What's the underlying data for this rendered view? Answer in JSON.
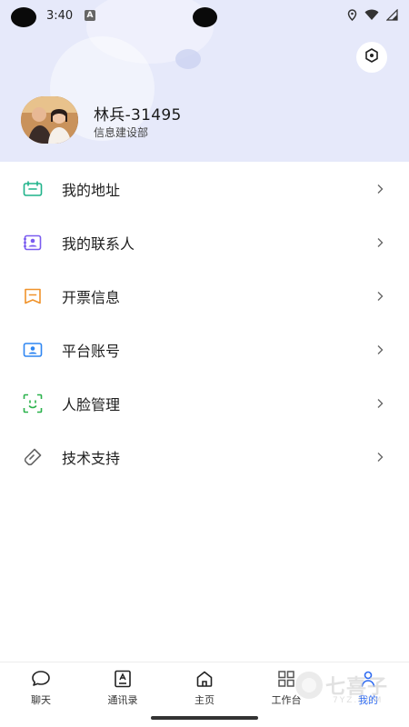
{
  "status_bar": {
    "time": "3:40",
    "notification_icon": "A"
  },
  "profile": {
    "name": "林兵-31495",
    "department": "信息建设部",
    "avatar": "profile-photo"
  },
  "menu": {
    "items": [
      {
        "label": "我的地址",
        "icon": "address-icon",
        "color": "#1fb38a"
      },
      {
        "label": "我的联系人",
        "icon": "contacts-icon",
        "color": "#7a5cf0"
      },
      {
        "label": "开票信息",
        "icon": "invoice-icon",
        "color": "#f0932b"
      },
      {
        "label": "平台账号",
        "icon": "account-icon",
        "color": "#2f86f2"
      },
      {
        "label": "人脸管理",
        "icon": "face-icon",
        "color": "#2bb24c"
      },
      {
        "label": "技术支持",
        "icon": "support-icon",
        "color": "#666666"
      }
    ]
  },
  "bottom_nav": {
    "items": [
      {
        "label": "聊天",
        "icon": "chat-icon"
      },
      {
        "label": "通讯录",
        "icon": "address-book-icon"
      },
      {
        "label": "主页",
        "icon": "home-icon"
      },
      {
        "label": "工作台",
        "icon": "workbench-icon"
      },
      {
        "label": "我的",
        "icon": "me-icon",
        "active": true
      }
    ]
  },
  "watermark": {
    "text": "七喜子",
    "sub": "7YZ.COM"
  },
  "colors": {
    "header_bg": "#e6e9fa",
    "accent": "#2f6bf2"
  }
}
